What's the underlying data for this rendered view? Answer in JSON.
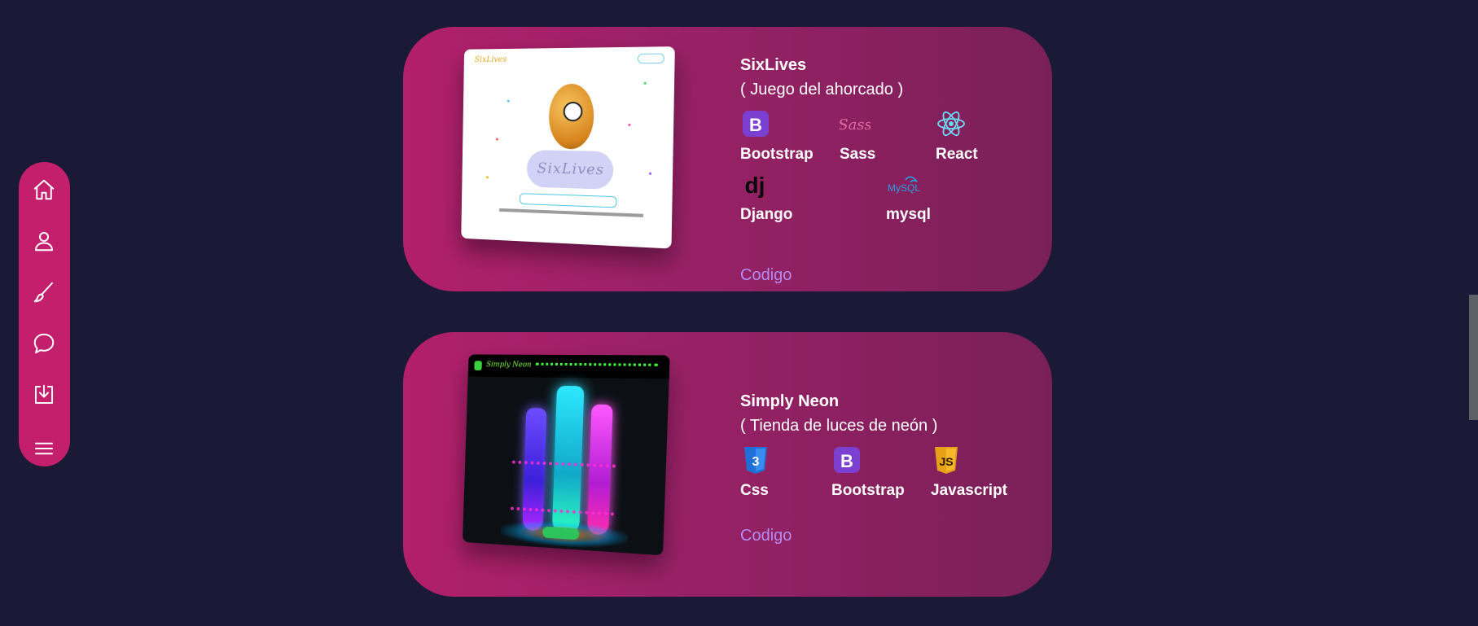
{
  "sidebar": {
    "items": [
      {
        "icon": "home-icon",
        "label": "Inicio"
      },
      {
        "icon": "user-icon",
        "label": "Sobre mí"
      },
      {
        "icon": "brush-icon",
        "label": "Proyectos"
      },
      {
        "icon": "chat-icon",
        "label": "Contacto"
      },
      {
        "icon": "download-icon",
        "label": "Descargar"
      },
      {
        "icon": "menu-icon",
        "label": "Menú"
      }
    ],
    "colors": {
      "background": "#c41f6d",
      "icon": "#ffffff"
    }
  },
  "projects": [
    {
      "title": "SixLives",
      "subtitle": "( Juego del ahorcado )",
      "preview_text": "SixLives",
      "technologies": [
        {
          "name": "Bootstrap",
          "icon": "bootstrap-icon"
        },
        {
          "name": "Sass",
          "icon": "sass-icon"
        },
        {
          "name": "React",
          "icon": "react-icon"
        },
        {
          "name": "Django",
          "icon": "django-icon"
        },
        {
          "name": "mysql",
          "icon": "mysql-icon"
        }
      ],
      "link_label": "Codigo"
    },
    {
      "title": "Simply Neon",
      "subtitle": "( Tienda de luces de neón )",
      "preview_text": "Simply Neon",
      "technologies": [
        {
          "name": "Css",
          "icon": "css3-icon"
        },
        {
          "name": "Bootstrap",
          "icon": "bootstrap-icon"
        },
        {
          "name": "Javascript",
          "icon": "javascript-icon"
        }
      ],
      "link_label": "Codigo"
    }
  ],
  "theme": {
    "page_background": "#1b1a36",
    "card_gradient_start": "#b21f6b",
    "card_gradient_end": "#7a2058",
    "link_color": "#b48cf2"
  }
}
